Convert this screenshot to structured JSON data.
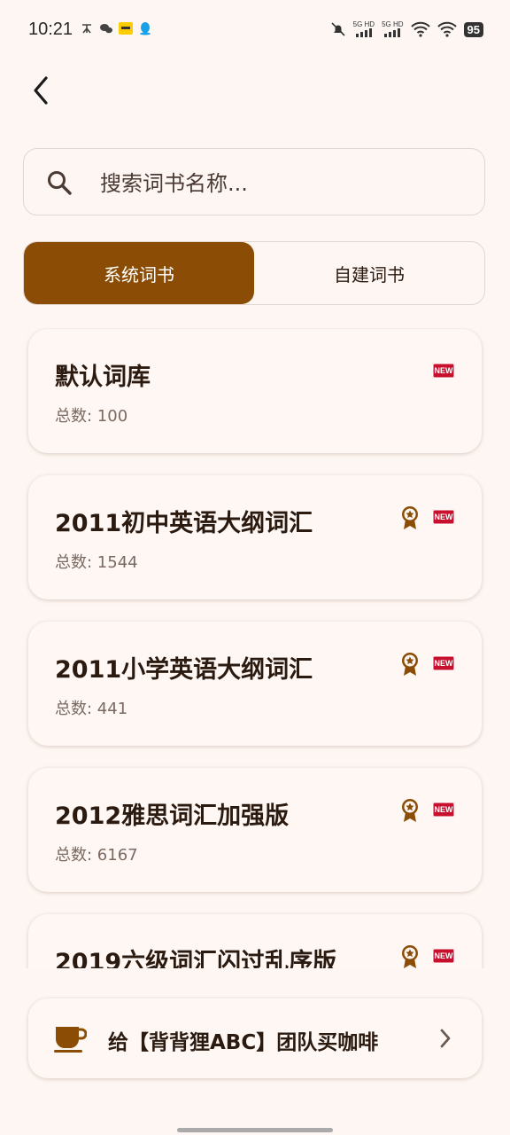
{
  "status_bar": {
    "time": "10:21",
    "net1": "5G HD",
    "net2": "5G HD",
    "battery": "95"
  },
  "search": {
    "placeholder": "搜索词书名称..."
  },
  "tabs": [
    {
      "label": "系统词书",
      "active": true
    },
    {
      "label": "自建词书",
      "active": false
    }
  ],
  "books": [
    {
      "title": "默认词库",
      "count": "总数: 100",
      "has_award": false,
      "badge": "NEW"
    },
    {
      "title": "2011初中英语大纲词汇",
      "count": "总数: 1544",
      "has_award": true,
      "badge": "NEW"
    },
    {
      "title": "2011小学英语大纲词汇",
      "count": "总数: 441",
      "has_award": true,
      "badge": "NEW"
    },
    {
      "title": "2012雅思词汇加强版",
      "count": "总数: 6167",
      "has_award": true,
      "badge": "NEW"
    },
    {
      "title": "2019六级词汇闪过乱序版",
      "count": "",
      "has_award": true,
      "badge": "NEW"
    }
  ],
  "coffee": {
    "label": "给【背背狸ABC】团队买咖啡"
  },
  "colors": {
    "accent": "#8b4d06",
    "background": "#fdf6f2",
    "new_badge": "#c8102e"
  }
}
